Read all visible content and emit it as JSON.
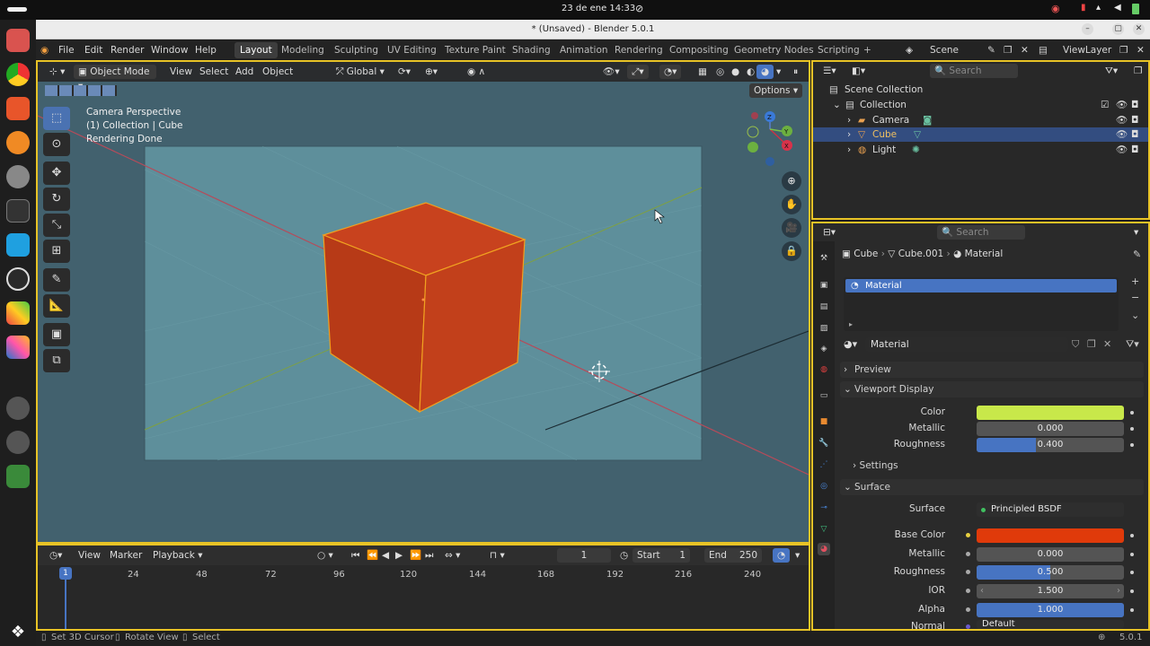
{
  "system": {
    "datetime": "23 de ene  14:33"
  },
  "window": {
    "title": "* (Unsaved) - Blender 5.0.1"
  },
  "menu": {
    "file": "File",
    "edit": "Edit",
    "render": "Render",
    "window": "Window",
    "help": "Help"
  },
  "workspaces": [
    "Layout",
    "Modeling",
    "Sculpting",
    "UV Editing",
    "Texture Paint",
    "Shading",
    "Animation",
    "Rendering",
    "Compositing",
    "Geometry Nodes",
    "Scripting"
  ],
  "scene": {
    "name": "Scene",
    "view_layer": "ViewLayer"
  },
  "viewport": {
    "mode": "Object Mode",
    "menus": [
      "View",
      "Select",
      "Add",
      "Object"
    ],
    "orientation": "Global",
    "options": "Options",
    "overlay_lines": [
      "Camera Perspective",
      "(1) Collection | Cube",
      "Rendering Done"
    ],
    "gizmo_labels": {
      "z": "Z",
      "y": "Y",
      "x": "X"
    }
  },
  "timeline": {
    "menus": [
      "View",
      "Marker",
      "Playback"
    ],
    "current_frame": "1",
    "start_label": "Start",
    "start": "1",
    "end_label": "End",
    "end": "250",
    "ticks": [
      "24",
      "48",
      "72",
      "96",
      "120",
      "144",
      "168",
      "192",
      "216",
      "240"
    ],
    "playhead": "1"
  },
  "statusbar": {
    "set_cursor": "Set 3D Cursor",
    "rotate": "Rotate View",
    "select": "Select",
    "version": "5.0.1"
  },
  "outliner": {
    "search_placeholder": "Search",
    "root": "Scene Collection",
    "items": [
      {
        "label": "Collection"
      },
      {
        "label": "Camera"
      },
      {
        "label": "Cube"
      },
      {
        "label": "Light"
      }
    ]
  },
  "properties": {
    "search_placeholder": "Search",
    "breadcrumb": [
      "Cube",
      "Cube.001",
      "Material"
    ],
    "slot": "Material",
    "material_name": "Material",
    "preview": "Preview",
    "viewport_display": "Viewport Display",
    "vd_color_label": "Color",
    "vd_metallic_label": "Metallic",
    "vd_metallic": "0.000",
    "vd_roughness_label": "Roughness",
    "vd_roughness": "0.400",
    "settings": "Settings",
    "surface_section": "Surface",
    "surface_label": "Surface",
    "surface_value": "Principled BSDF",
    "base_color_label": "Base Color",
    "metallic_label": "Metallic",
    "metallic": "0.000",
    "roughness_label": "Roughness",
    "roughness": "0.500",
    "ior_label": "IOR",
    "ior": "1.500",
    "alpha_label": "Alpha",
    "alpha": "1.000",
    "normal_label": "Normal",
    "normal_value": "Default",
    "colors": {
      "viewport_color": "#c8e84a",
      "base_color": "#e03a0a",
      "accent": "#4774c2"
    }
  }
}
